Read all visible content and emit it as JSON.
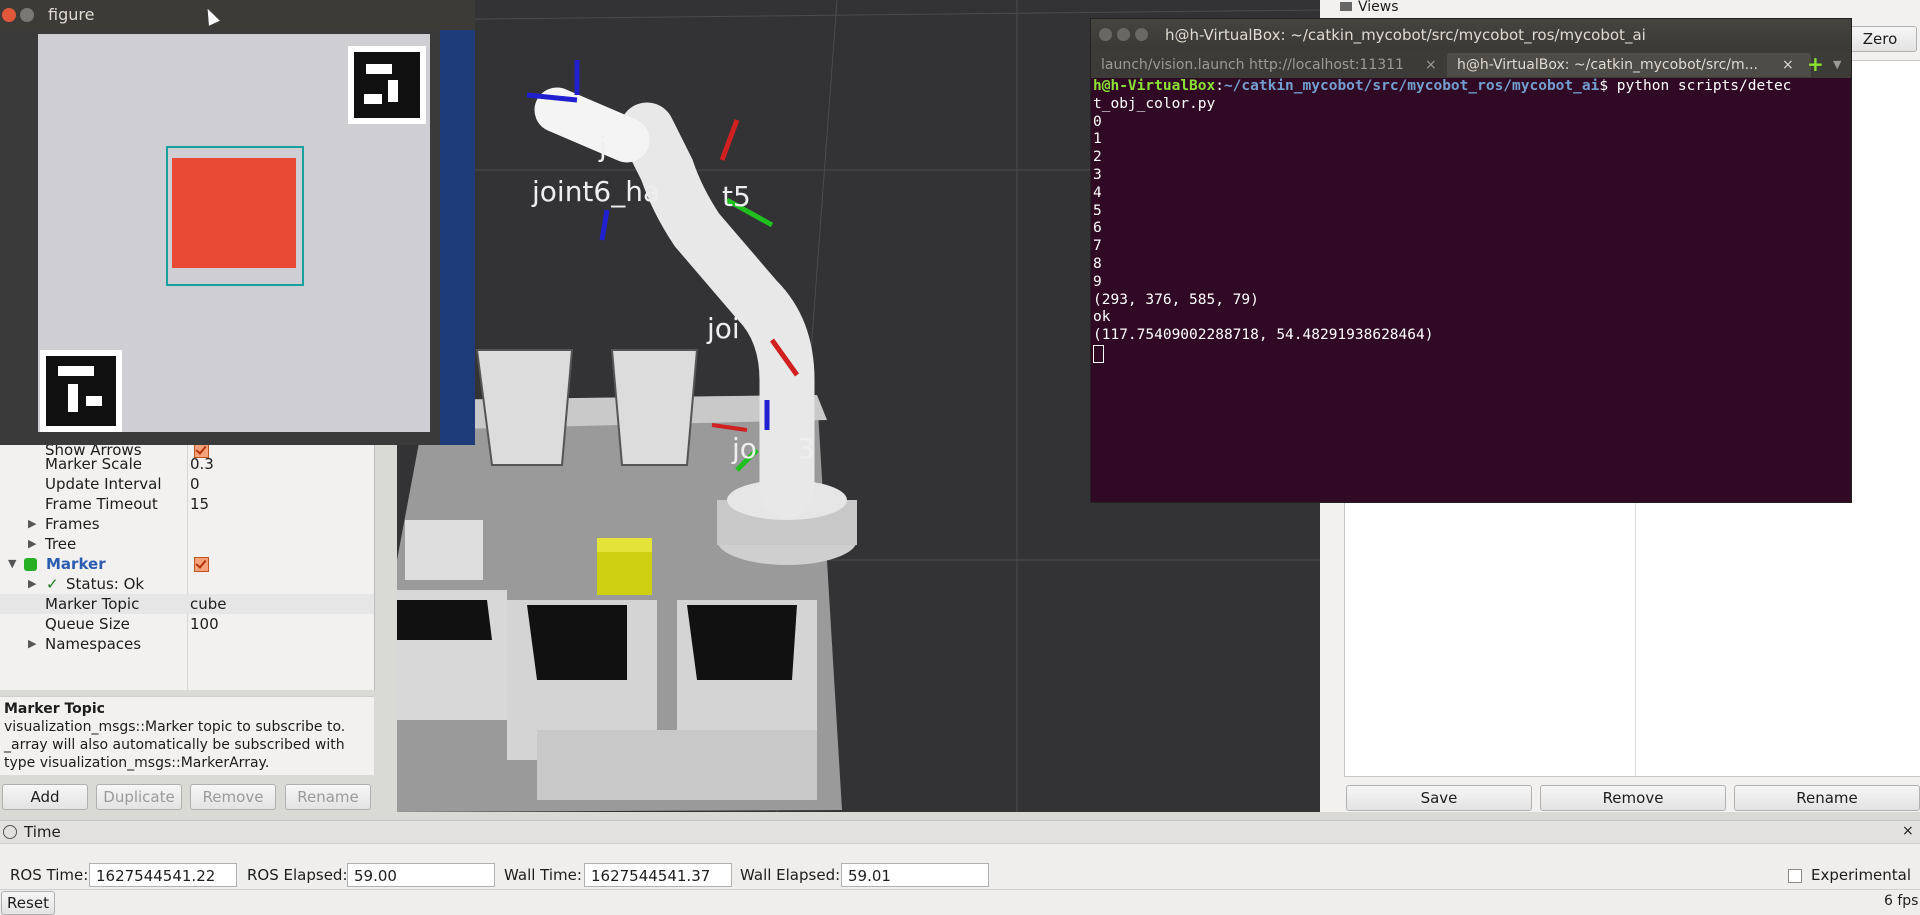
{
  "figure_window": {
    "title": "figure"
  },
  "displays": {
    "rows": [
      {
        "label": "Show Arrows",
        "value": ""
      },
      {
        "label": "Marker Scale",
        "value": "0.3"
      },
      {
        "label": "Update Interval",
        "value": "0"
      },
      {
        "label": "Frame Timeout",
        "value": "15"
      },
      {
        "label": "Frames",
        "value": ""
      },
      {
        "label": "Tree",
        "value": ""
      },
      {
        "label": "Marker",
        "value": ""
      },
      {
        "label": "Status: Ok",
        "value": ""
      },
      {
        "label": "Marker Topic",
        "value": "cube"
      },
      {
        "label": "Queue Size",
        "value": "100"
      },
      {
        "label": "Namespaces",
        "value": ""
      }
    ],
    "status_check": "✓"
  },
  "description": {
    "title": "Marker Topic",
    "lines": [
      "visualization_msgs::Marker topic to subscribe to.",
      "_array will also automatically be subscribed with",
      "type visualization_msgs::MarkerArray."
    ]
  },
  "display_buttons": {
    "add": "Add",
    "duplicate": "Duplicate",
    "remove": "Remove",
    "rename": "Rename"
  },
  "viewport": {
    "labels": [
      "j",
      "joint6_ha",
      "t5",
      "joi",
      "jo",
      "3"
    ]
  },
  "terminal": {
    "title": "h@h-VirtualBox: ~/catkin_mycobot/src/mycobot_ros/mycobot_ai",
    "tabs": [
      "launch/vision.launch http://localhost:11311",
      "h@h-VirtualBox: ~/catkin_mycobot/src/m..."
    ],
    "prompt_user": "h@h-VirtualBox",
    "prompt_path": "~/catkin_mycobot/src/mycobot_ros/mycobot_ai",
    "command_line1": "$ python scripts/detec",
    "command_line2": "t_obj_color.py",
    "output": [
      "0",
      "1",
      "2",
      "3",
      "4",
      "5",
      "6",
      "7",
      "8",
      "9",
      "(293, 376, 585, 79)",
      "ok",
      "(117.75409002288718, 54.48291938628464)"
    ]
  },
  "views_panel": {
    "header": "Views",
    "zero_button": "Zero",
    "save": "Save",
    "remove": "Remove",
    "rename": "Rename"
  },
  "time": {
    "panel_title": "Time",
    "ros_time_label": "ROS Time:",
    "ros_time": "1627544541.22",
    "ros_elapsed_label": "ROS Elapsed:",
    "ros_elapsed": "59.00",
    "wall_time_label": "Wall Time:",
    "wall_time": "1627544541.37",
    "wall_elapsed_label": "Wall Elapsed:",
    "wall_elapsed": "59.01",
    "experimental": "Experimental",
    "reset": "Reset",
    "fps": "6 fps"
  }
}
